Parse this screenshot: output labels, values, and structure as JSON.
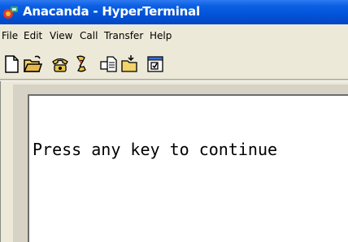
{
  "window": {
    "title": "Anacanda - HyperTerminal"
  },
  "menu": {
    "items": [
      "File",
      "Edit",
      "View",
      "Call",
      "Transfer",
      "Help"
    ]
  },
  "toolbar": {
    "buttons": [
      {
        "icon": "new-document-icon"
      },
      {
        "icon": "open-folder-icon"
      },
      {
        "icon": "dial-phone-icon"
      },
      {
        "icon": "disconnect-icon"
      },
      {
        "icon": "send-file-icon"
      },
      {
        "icon": "receive-file-icon"
      },
      {
        "icon": "properties-icon"
      }
    ]
  },
  "terminal": {
    "text": "Press any key to continue"
  },
  "colors": {
    "titlebar": "#0353d8",
    "face": "#ece9d8"
  }
}
